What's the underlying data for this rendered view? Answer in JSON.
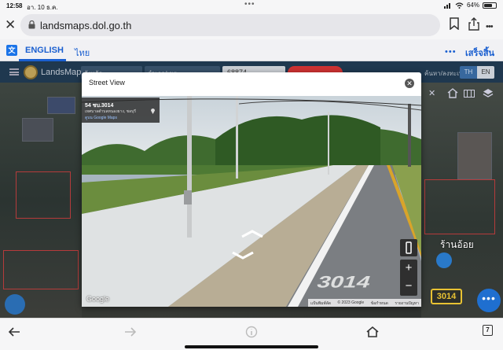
{
  "status_bar": {
    "time": "12:58",
    "date": "อา. 10 ธ.ค.",
    "battery": "64%",
    "battery_level": 0.64
  },
  "browser": {
    "url": "landsmaps.dol.go.th"
  },
  "translate_bar": {
    "english": "ENGLISH",
    "thai": "ไทย",
    "more": "•••",
    "done": "เสร็จสิ้น"
  },
  "app": {
    "title": "LandsMaps",
    "select_1": "จังหวัด",
    "select_2": "อำเภอ/เขต",
    "search_value": "68874",
    "header_link": "ค้นหา/ลงทะเบียน",
    "lang_th": "TH",
    "lang_en": "EN",
    "parcel_label": "3014",
    "place_label": "ร้านอ้อย"
  },
  "street_view": {
    "title": "Street View",
    "location_title": "54 ชบ.3014",
    "address": "เทศบาลตำบลหนองยาง, ชลบุรี",
    "open_link": "ดูบน Google Maps",
    "google_logo": "Google",
    "footer": [
      "แป้นพิมพ์ลัด",
      "© 2023 Google",
      "ข้อกำหนด",
      "รายงานปัญหา"
    ],
    "road_marking": "3014",
    "zoom_in": "+",
    "zoom_out": "−"
  },
  "bottom_bar": {
    "tabs_count": "7"
  }
}
